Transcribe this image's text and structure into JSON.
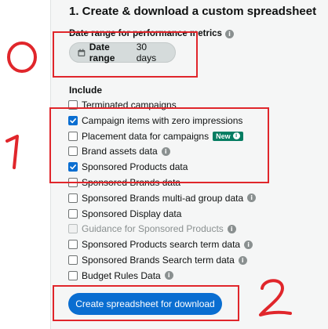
{
  "section": {
    "title": "1. Create & download a custom spreadsheet"
  },
  "date_range": {
    "label": "Date range for performance metrics",
    "button_label_bold": "Date range",
    "button_value": "30 days"
  },
  "include": {
    "label": "Include",
    "options": [
      {
        "label": "Terminated campaigns",
        "checked": false,
        "disabled": false
      },
      {
        "label": "Campaign items with zero impressions",
        "checked": true,
        "disabled": false
      },
      {
        "label": "Placement data for campaigns",
        "checked": false,
        "disabled": false,
        "badge": "New"
      },
      {
        "label": "Brand assets data",
        "checked": false,
        "disabled": false,
        "info": true
      },
      {
        "label": "Sponsored Products data",
        "checked": true,
        "disabled": false
      },
      {
        "label": "Sponsored Brands data",
        "checked": false,
        "disabled": false
      },
      {
        "label": "Sponsored Brands multi-ad group data",
        "checked": false,
        "disabled": false,
        "info": true
      },
      {
        "label": "Sponsored Display data",
        "checked": false,
        "disabled": false
      },
      {
        "label": "Guidance for Sponsored Products",
        "checked": false,
        "disabled": true,
        "info": true
      },
      {
        "label": "Sponsored Products search term data",
        "checked": false,
        "disabled": false,
        "info": true
      },
      {
        "label": "Sponsored Brands Search term data",
        "checked": false,
        "disabled": false,
        "info": true
      },
      {
        "label": "Budget Rules Data",
        "checked": false,
        "disabled": false,
        "info": true
      }
    ]
  },
  "create_button": {
    "label": "Create spreadsheet for download"
  },
  "annotations": {
    "zero": "0",
    "one": "1",
    "two": "2"
  },
  "colors": {
    "accent": "#0a6ed1",
    "annotation": "#e0262b",
    "badge": "#067d62"
  }
}
